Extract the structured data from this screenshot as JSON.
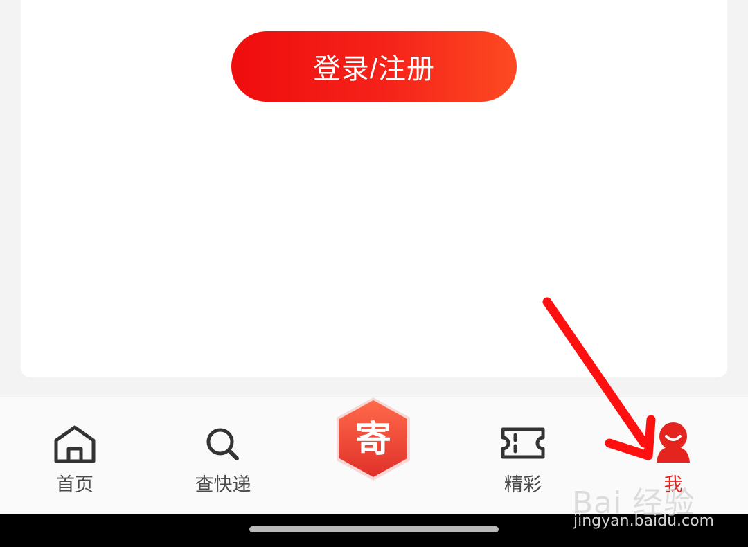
{
  "main": {
    "login_register_label": "登录/注册"
  },
  "tabbar": {
    "center_icon_glyph": "寄",
    "accent_color": "#e4251f",
    "items": [
      {
        "label": "首页",
        "icon": "home-icon"
      },
      {
        "label": "查快递",
        "icon": "search-icon"
      },
      {
        "label": "精彩",
        "icon": "ticket-icon"
      },
      {
        "label": "我",
        "icon": "profile-icon",
        "active": true
      }
    ]
  },
  "watermark": {
    "logo_text": "Bai 经验",
    "url": "jingyan.baidu.com"
  }
}
